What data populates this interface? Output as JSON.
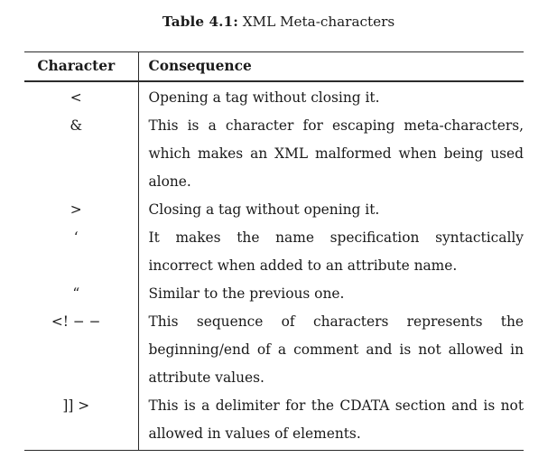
{
  "caption": {
    "label": "Table 4.1:",
    "text": "XML Meta-characters"
  },
  "table": {
    "columns": [
      {
        "key": "character",
        "header": "Character"
      },
      {
        "key": "consequence",
        "header": "Consequence"
      }
    ],
    "rows": [
      {
        "character": "<",
        "consequence": "Opening a tag without closing it.",
        "lines": 1
      },
      {
        "character": "&",
        "consequence": "This is a character for escaping meta-characters, which makes an XML malformed when being used alone.",
        "lines": 3
      },
      {
        "character": ">",
        "consequence": "Closing a tag without opening it.",
        "lines": 1
      },
      {
        "character": "‘",
        "consequence": "It makes the name specification syntactically incorrect when added to an attribute name.",
        "lines": 2
      },
      {
        "character": "“",
        "consequence": "Similar to the previous one.",
        "lines": 1
      },
      {
        "character": "<! − −",
        "consequence": "This sequence of characters represents the beginning/end of a comment and is not allowed in attribute values.",
        "lines": 3
      },
      {
        "character": "]] >",
        "consequence": "This is a delimiter for the CDATA section and is not allowed in values of elements.",
        "lines": 2
      }
    ]
  },
  "style": {
    "rule_color": "#2b2b2b",
    "text_color": "#1a1a1a",
    "background": "#ffffff"
  }
}
